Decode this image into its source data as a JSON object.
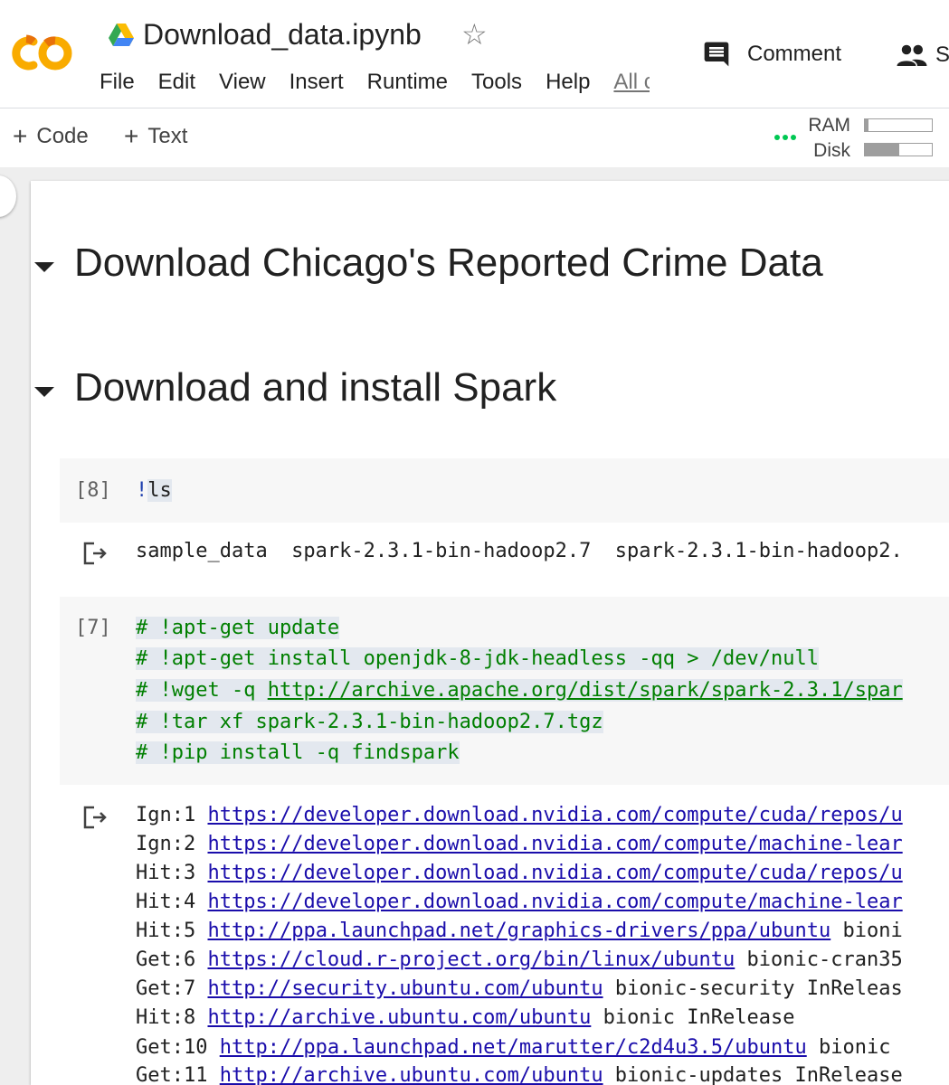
{
  "header": {
    "title": "Download_data.ipynb",
    "menu": [
      "File",
      "Edit",
      "View",
      "Insert",
      "Runtime",
      "Tools",
      "Help",
      "All c"
    ],
    "comment_label": "Comment",
    "share_label": "S"
  },
  "toolbar": {
    "add_code": "Code",
    "add_text": "Text",
    "ram_label": "RAM",
    "disk_label": "Disk",
    "ram_usage": 0.05,
    "disk_usage": 0.52,
    "status_color": "#00c853"
  },
  "sections": [
    {
      "title": "Download Chicago's Reported Crime Data"
    },
    {
      "title": "Download and install Spark"
    }
  ],
  "cells": [
    {
      "prompt": "[8]",
      "code_bang": "!",
      "code_rest": "ls",
      "output": "sample_data  spark-2.3.1-bin-hadoop2.7  spark-2.3.1-bin-hadoop2."
    },
    {
      "prompt": "[7]",
      "lines": [
        "# !apt-get update",
        "# !apt-get install openjdk-8-jdk-headless -qq > /dev/null",
        "# !wget -q ",
        "# !tar xf spark-2.3.1-bin-hadoop2.7.tgz",
        "# !pip install -q findspark"
      ],
      "wget_url": "http://archive.apache.org/dist/spark/spark-2.3.1/spar",
      "output": [
        {
          "pre": "Ign:1 ",
          "url": "https://developer.download.nvidia.com/compute/cuda/repos/u",
          "post": ""
        },
        {
          "pre": "Ign:2 ",
          "url": "https://developer.download.nvidia.com/compute/machine-lear",
          "post": ""
        },
        {
          "pre": "Hit:3 ",
          "url": "https://developer.download.nvidia.com/compute/cuda/repos/u",
          "post": ""
        },
        {
          "pre": "Hit:4 ",
          "url": "https://developer.download.nvidia.com/compute/machine-lear",
          "post": ""
        },
        {
          "pre": "Hit:5 ",
          "url": "http://ppa.launchpad.net/graphics-drivers/ppa/ubuntu",
          "post": " bioni"
        },
        {
          "pre": "Get:6 ",
          "url": "https://cloud.r-project.org/bin/linux/ubuntu",
          "post": " bionic-cran35"
        },
        {
          "pre": "Get:7 ",
          "url": "http://security.ubuntu.com/ubuntu",
          "post": " bionic-security InReleas"
        },
        {
          "pre": "Hit:8 ",
          "url": "http://archive.ubuntu.com/ubuntu",
          "post": " bionic InRelease"
        },
        {
          "pre": "Get:10 ",
          "url": "http://ppa.launchpad.net/marutter/c2d4u3.5/ubuntu",
          "post": " bionic"
        },
        {
          "pre": "Get:11 ",
          "url": "http://archive.ubuntu.com/ubuntu",
          "post": " bionic-updates InRelease"
        }
      ]
    }
  ]
}
